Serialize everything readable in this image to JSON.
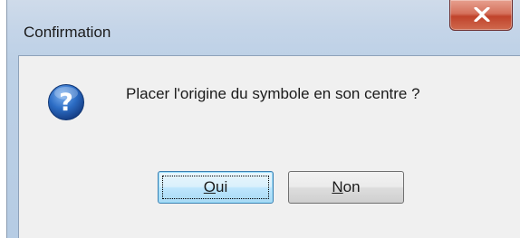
{
  "window": {
    "title": "Confirmation",
    "close_icon": "close-x-icon"
  },
  "dialog": {
    "icon": "question-icon",
    "message": "Placer l'origine du symbole en son centre ?"
  },
  "buttons": {
    "yes": {
      "mnemonic": "O",
      "rest": "ui",
      "label": "Oui"
    },
    "no": {
      "mnemonic": "N",
      "rest": "on",
      "label": "Non"
    }
  },
  "colors": {
    "close_button": "#c7472d",
    "question_icon": "#1f5fb8",
    "default_button_border": "#3c7fb1"
  }
}
